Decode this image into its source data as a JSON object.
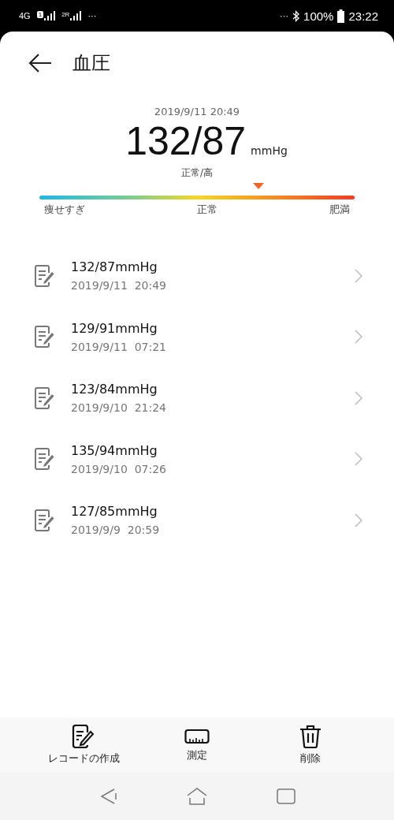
{
  "status_bar": {
    "network": "4G",
    "sim1": "1",
    "sim2": "2R",
    "left_more": "···",
    "right_more": "···",
    "battery": "100%",
    "time": "23:22"
  },
  "header": {
    "title": "血圧"
  },
  "summary": {
    "datetime": "2019/9/11 20:49",
    "value": "132/87",
    "unit": "mmHg",
    "category": "正常/高",
    "level": 0.695,
    "scale_labels": [
      "痩せすぎ",
      "正常",
      "肥満"
    ]
  },
  "records": [
    {
      "value": "132/87mmHg",
      "date": "2019/9/11",
      "time": "20:49"
    },
    {
      "value": "129/91mmHg",
      "date": "2019/9/11",
      "time": "07:21"
    },
    {
      "value": "123/84mmHg",
      "date": "2019/9/10",
      "time": "21:24"
    },
    {
      "value": "135/94mmHg",
      "date": "2019/9/10",
      "time": "07:26"
    },
    {
      "value": "127/85mmHg",
      "date": "2019/9/9",
      "time": "20:59"
    }
  ],
  "toolbar": [
    {
      "kind": "create",
      "label": "レコードの作成"
    },
    {
      "kind": "measure",
      "label": "測定"
    },
    {
      "kind": "delete",
      "label": "削除"
    }
  ]
}
